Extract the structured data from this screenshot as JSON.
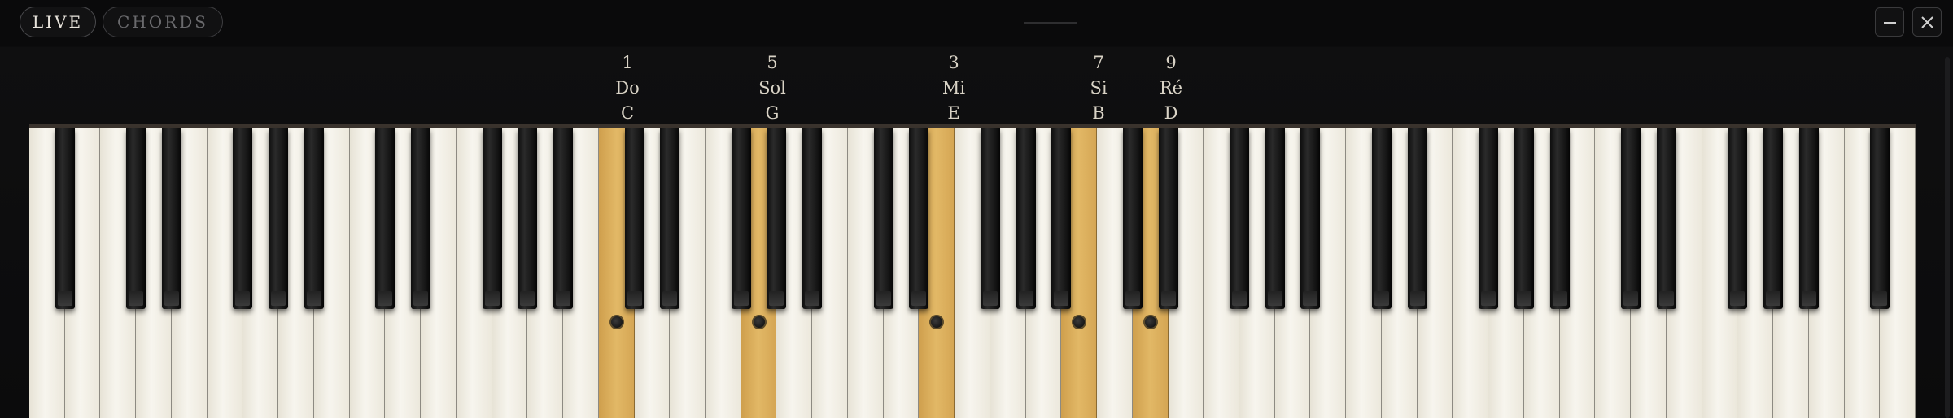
{
  "tabs": [
    {
      "label": "LIVE",
      "active": true
    },
    {
      "label": "CHORDS",
      "active": false
    }
  ],
  "window": {
    "minimize_icon": "minimize-icon",
    "close_icon": "close-icon"
  },
  "keyboard": {
    "white_key_count": 53,
    "highlight_color": "#e2b866"
  },
  "chord_notes": [
    {
      "degree": "1",
      "solfege": "Do",
      "letter": "C"
    },
    {
      "degree": "5",
      "solfege": "Sol",
      "letter": "G"
    },
    {
      "degree": "3",
      "solfege": "Mi",
      "letter": "E"
    },
    {
      "degree": "7",
      "solfege": "Si",
      "letter": "B"
    },
    {
      "degree": "9",
      "solfege": "Ré",
      "letter": "D"
    }
  ]
}
